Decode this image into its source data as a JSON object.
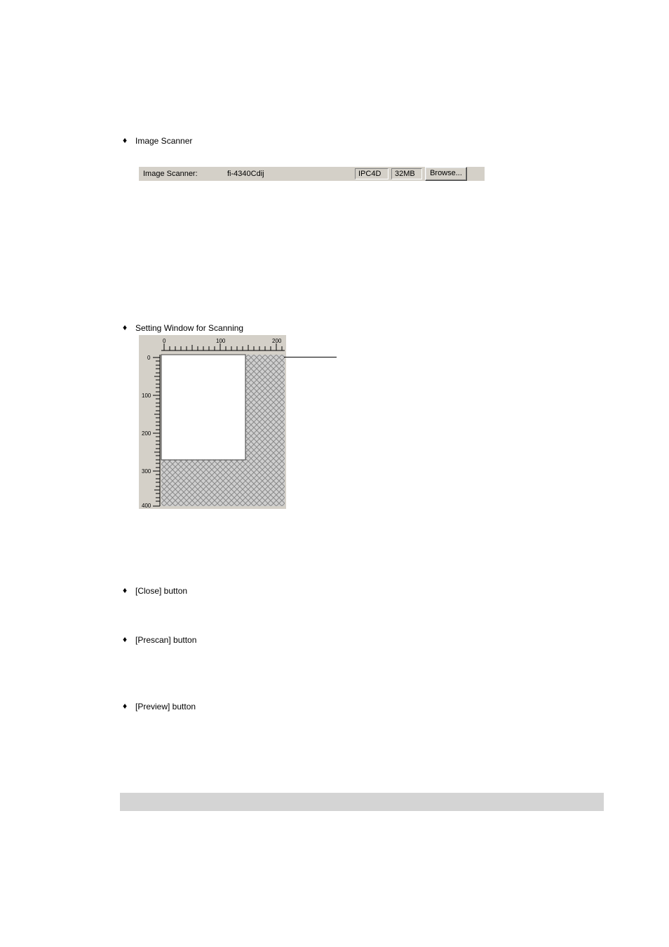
{
  "bullets": {
    "image_scanner": "Image Scanner",
    "setting_window": "Setting Window for Scanning",
    "close": "[Close] button",
    "prescan": "[Prescan] button",
    "preview": "[Preview] button"
  },
  "scanner_bar": {
    "label": "Image Scanner:",
    "value": "fi-4340Cdij",
    "ipc": "IPC4D",
    "mem": "32MB",
    "browse": "Browse..."
  },
  "preview_ruler": {
    "h0": "0",
    "h100": "100",
    "h200": "200",
    "v0": "0",
    "v100": "100",
    "v200": "200",
    "v300": "300",
    "v400": "400"
  }
}
